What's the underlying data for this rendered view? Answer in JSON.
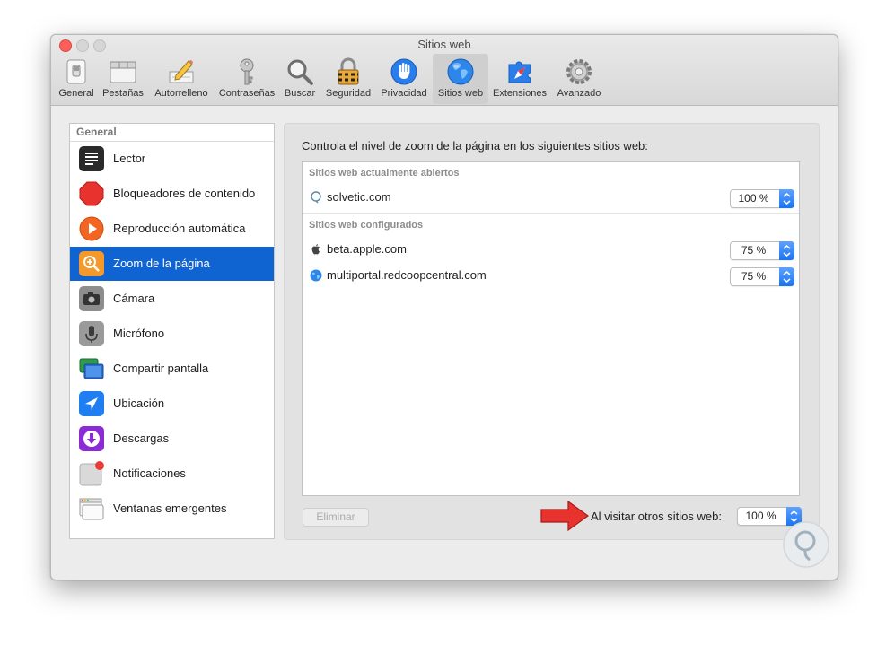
{
  "window": {
    "title": "Sitios web"
  },
  "toolbar": {
    "items": [
      {
        "label": "General"
      },
      {
        "label": "Pestañas"
      },
      {
        "label": "Autorrelleno"
      },
      {
        "label": "Contraseñas"
      },
      {
        "label": "Buscar"
      },
      {
        "label": "Seguridad"
      },
      {
        "label": "Privacidad"
      },
      {
        "label": "Sitios web",
        "selected": true
      },
      {
        "label": "Extensiones"
      },
      {
        "label": "Avanzado"
      }
    ]
  },
  "sidebar": {
    "header": "General",
    "items": [
      {
        "label": "Lector",
        "icon": "lector-icon"
      },
      {
        "label": "Bloqueadores de contenido",
        "icon": "stop-icon"
      },
      {
        "label": "Reproducción automática",
        "icon": "play-icon"
      },
      {
        "label": "Zoom de la página",
        "icon": "zoom-icon",
        "selected": true
      },
      {
        "label": "Cámara",
        "icon": "camera-icon"
      },
      {
        "label": "Micrófono",
        "icon": "microphone-icon"
      },
      {
        "label": "Compartir pantalla",
        "icon": "screen-share-icon"
      },
      {
        "label": "Ubicación",
        "icon": "location-icon"
      },
      {
        "label": "Descargas",
        "icon": "download-icon"
      },
      {
        "label": "Notificaciones",
        "icon": "notifications-icon"
      },
      {
        "label": "Ventanas emergentes",
        "icon": "popup-windows-icon"
      }
    ]
  },
  "main": {
    "description": "Controla el nivel de zoom de la página en los siguientes sitios web:",
    "open_section": "Sitios web actualmente abiertos",
    "configured_section": "Sitios web configurados",
    "open_sites": [
      {
        "name": "solvetic.com",
        "zoom": "100 %"
      }
    ],
    "configured_sites": [
      {
        "name": "beta.apple.com",
        "zoom": "75 %"
      },
      {
        "name": "multiportal.redcoopcentral.com",
        "zoom": "75 %"
      }
    ],
    "remove_button": "Eliminar",
    "other_sites_label": "Al visitar otros sitios web:",
    "other_sites_zoom": "100 %"
  },
  "colors": {
    "selection": "#0f64d2",
    "close_button": "#fc5f57",
    "annotation_arrow": "#e8322e",
    "select_arrows": "#1a74ef"
  }
}
